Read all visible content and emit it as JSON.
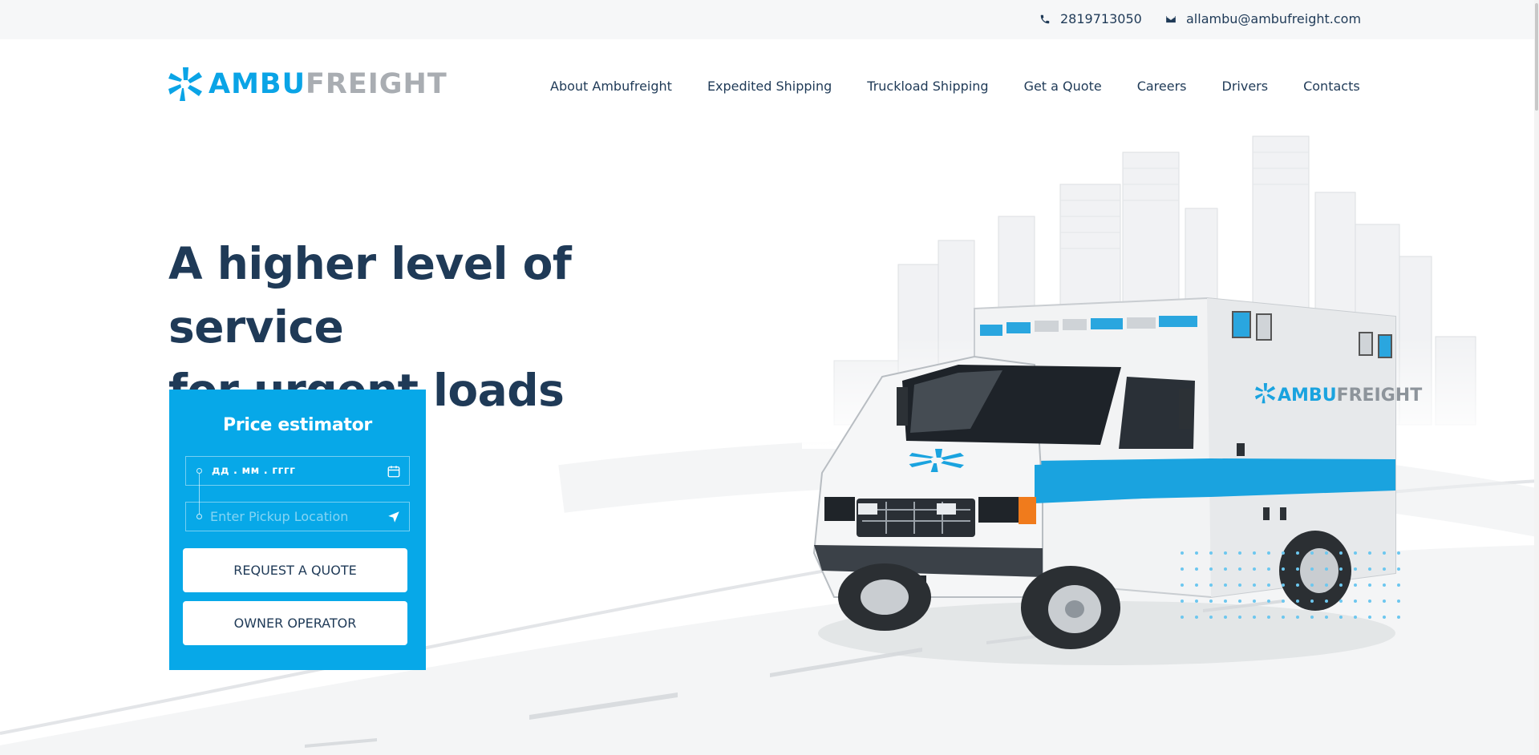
{
  "topbar": {
    "phone": "2819713050",
    "email": "allambu@ambufreight.com"
  },
  "logo": {
    "ambu": "AMBU",
    "freight": "FREIGHT"
  },
  "nav": {
    "items": [
      "About Ambufreight",
      "Expedited Shipping",
      "Truckload Shipping",
      "Get a Quote",
      "Careers",
      "Drivers",
      "Contacts"
    ]
  },
  "hero": {
    "headline_line1": "A higher level of service",
    "headline_line2": "for urgent loads",
    "vehicle_logo": {
      "ambu": "AMBU",
      "freight": "FREIGHT"
    }
  },
  "estimator": {
    "title": "Price estimator",
    "date_value": "дд . мм . гггг",
    "pickup_placeholder": "Enter Pickup Location",
    "request_quote_label": "REQUEST A QUOTE",
    "owner_operator_label": "OWNER OPERATOR"
  },
  "colors": {
    "brand_blue": "#07a8e8",
    "navy": "#1f3a57",
    "logo_gray": "#a9adb2",
    "topbar_bg": "#f6f7f8"
  },
  "icons": [
    "phone-icon",
    "mail-icon",
    "calendar-icon",
    "location-arrow-icon",
    "star-of-life-icon"
  ]
}
